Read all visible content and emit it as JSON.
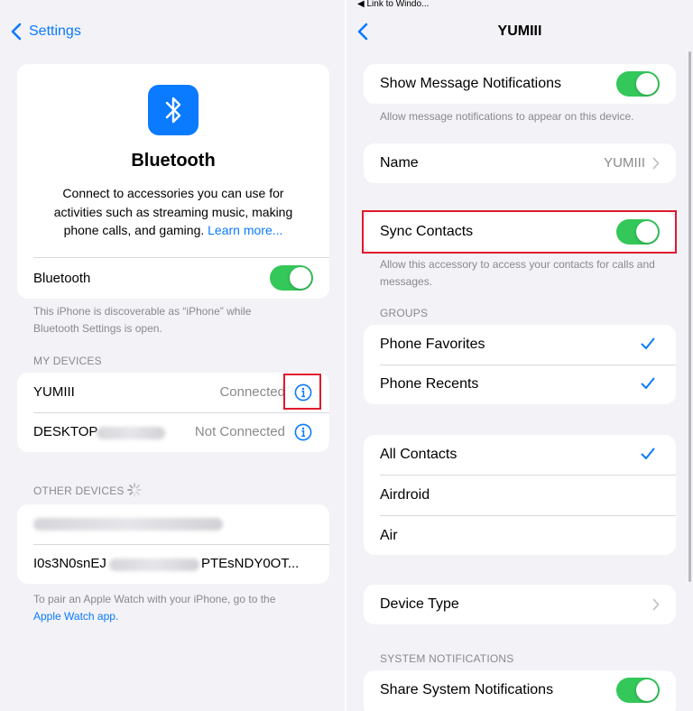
{
  "colors": {
    "accent": "#0a7aff",
    "toggle_on": "#34c759",
    "highlight": "#e0192e"
  },
  "left": {
    "nav": {
      "back_label": "Settings",
      "back_icon": "chevron-left-icon"
    },
    "header_card": {
      "icon": "bluetooth-icon",
      "title": "Bluetooth",
      "description": "Connect to accessories you can use for activities such as streaming music, making phone calls, and gaming.",
      "learn_more": "Learn more...",
      "toggle_label": "Bluetooth",
      "toggle_on": true
    },
    "discoverable_note": "This iPhone is discoverable as “iPhone” while Bluetooth Settings is open.",
    "my_devices": {
      "header": "MY DEVICES",
      "items": [
        {
          "name": "YUMIII",
          "status": "Connected",
          "icon": "info-icon"
        },
        {
          "name": "DESKTOP",
          "status": "Not Connected",
          "icon": "info-icon"
        }
      ]
    },
    "other_devices": {
      "header": "OTHER DEVICES",
      "spinner": "loading-spinner-icon",
      "items": [
        {
          "name": ""
        },
        {
          "name_prefix": "I0s3N0snEJ",
          "name_suffix": "PTEsNDY0OT..."
        }
      ]
    },
    "footer": {
      "text": "To pair an Apple Watch with your iPhone, go to the",
      "link": "Apple Watch app."
    }
  },
  "right": {
    "top_link": "◀ Link to Windo...",
    "nav": {
      "title": "YUMIII",
      "back_icon": "chevron-left-icon"
    },
    "message_notifications": {
      "label": "Show Message Notifications",
      "toggle_on": true,
      "caption": "Allow message notifications to appear on this device."
    },
    "name_row": {
      "label": "Name",
      "value": "YUMIII"
    },
    "sync_contacts": {
      "label": "Sync Contacts",
      "toggle_on": true,
      "caption": "Allow this accessory to access your contacts for calls and messages."
    },
    "groups": {
      "header": "GROUPS",
      "items": [
        {
          "label": "Phone Favorites",
          "checked": true
        },
        {
          "label": "Phone Recents",
          "checked": true
        }
      ]
    },
    "contacts": {
      "items": [
        {
          "label": "All Contacts",
          "checked": true
        },
        {
          "label": "Airdroid",
          "checked": false
        },
        {
          "label": "Air",
          "checked": false
        }
      ]
    },
    "device_type": {
      "label": "Device Type"
    },
    "system_notifications": {
      "header": "SYSTEM NOTIFICATIONS",
      "label": "Share System Notifications",
      "toggle_on": true
    }
  }
}
